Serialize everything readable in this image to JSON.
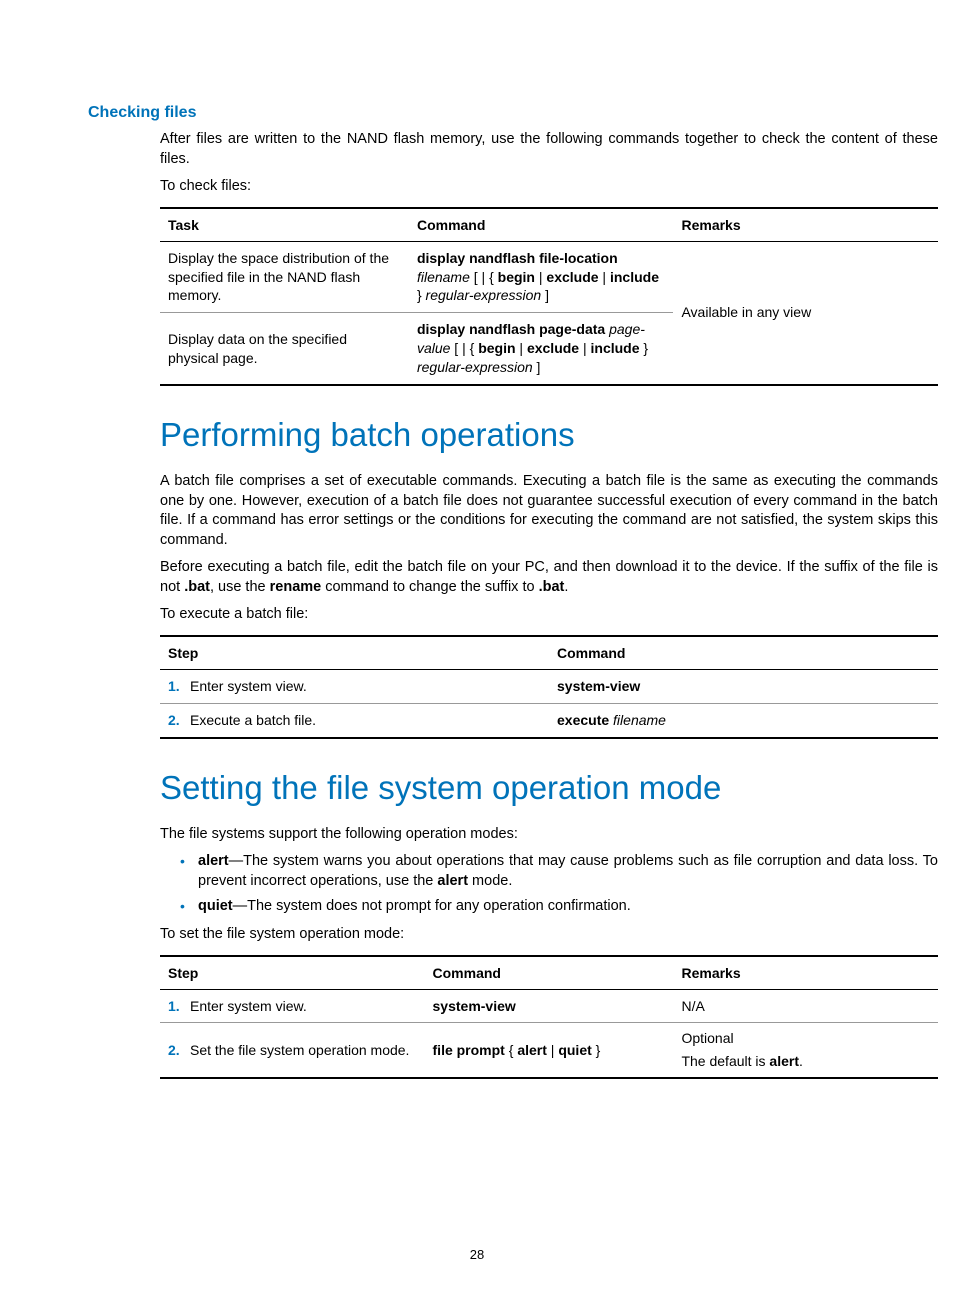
{
  "section1": {
    "heading": "Checking files",
    "para1": "After files are written to the NAND flash memory, use the following commands together to check the content of these files.",
    "para2": "To check files:",
    "table": {
      "headers": {
        "task": "Task",
        "command": "Command",
        "remarks": "Remarks"
      },
      "rows": [
        {
          "task": "Display the space distribution of the specified file in the NAND flash memory.",
          "cmd_b1": "display nandflash file-location",
          "cmd_i1": "filename",
          "cmd_mid1": " [ | { ",
          "cmd_b2": "begin",
          "cmd_sep1": " | ",
          "cmd_b3": "exclude",
          "cmd_sep2": " | ",
          "cmd_b4": "include",
          "cmd_close": " } ",
          "cmd_i2": "regular-expression",
          "cmd_end": " ]"
        },
        {
          "task": "Display data on the specified physical page.",
          "cmd_b1": "display nandflash page-data",
          "cmd_i1": "page-value",
          "cmd_mid1": " [ | { ",
          "cmd_b2": "begin",
          "cmd_sep1": " | ",
          "cmd_b3": "exclude",
          "cmd_sep2": " | ",
          "cmd_b4": "include",
          "cmd_close": " } ",
          "cmd_i2": "regular-expression",
          "cmd_end": " ]"
        }
      ],
      "remarks": "Available in any view"
    }
  },
  "section2": {
    "heading": "Performing batch operations",
    "para1": "A batch file comprises a set of executable commands. Executing a batch file is the same as executing the commands one by one. However, execution of a batch file does not guarantee successful execution of every command in the batch file. If a command has error settings or the conditions for executing the command are not satisfied, the system skips this command.",
    "para2_pre": "Before executing a batch file, edit the batch file on your PC, and then download it to the device. If the suffix of the file is not ",
    "para2_b1": ".bat",
    "para2_mid": ", use the ",
    "para2_b2": "rename",
    "para2_mid2": " command to change the suffix to ",
    "para2_b3": ".bat",
    "para2_end": ".",
    "para3": "To execute a batch file:",
    "table": {
      "headers": {
        "step": "Step",
        "command": "Command"
      },
      "rows": [
        {
          "num": "1.",
          "step": "Enter system view.",
          "cmd_b1": "system-view"
        },
        {
          "num": "2.",
          "step": "Execute a batch file.",
          "cmd_b1": "execute",
          "cmd_sp": " ",
          "cmd_i1": "filename"
        }
      ]
    }
  },
  "section3": {
    "heading": "Setting the file system operation mode",
    "para1": "The file systems support the following operation modes:",
    "bullets": [
      {
        "b1": "alert",
        "t1": "—The system warns you about operations that may cause problems such as file corruption and data loss. To prevent incorrect operations, use the ",
        "b2": "alert",
        "t2": " mode."
      },
      {
        "b1": "quiet",
        "t1": "—The system does not prompt for any operation confirmation."
      }
    ],
    "para2": "To set the file system operation mode:",
    "table": {
      "headers": {
        "step": "Step",
        "command": "Command",
        "remarks": "Remarks"
      },
      "rows": [
        {
          "num": "1.",
          "step": "Enter system view.",
          "cmd_b1": "system-view",
          "remarks": "N/A"
        },
        {
          "num": "2.",
          "step": "Set the file system operation mode.",
          "cmd_b1": "file prompt",
          "cmd_mid1": " { ",
          "cmd_b2": "alert",
          "cmd_sep1": " | ",
          "cmd_b3": "quiet",
          "cmd_close": " }",
          "remarks_line1": "Optional",
          "remarks_line2_pre": "The default is ",
          "remarks_line2_b": "alert",
          "remarks_line2_end": "."
        }
      ]
    }
  },
  "pagenum": "28"
}
